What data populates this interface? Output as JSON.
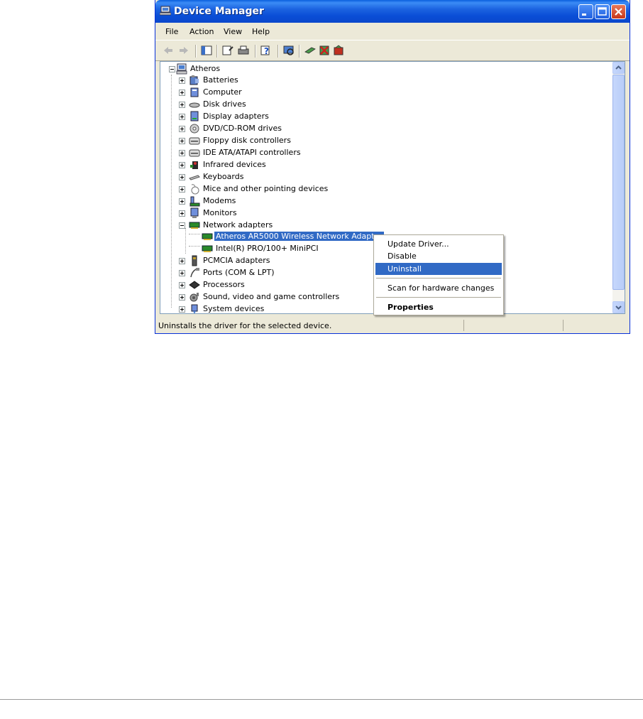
{
  "window": {
    "title": "Device Manager"
  },
  "menu": [
    "File",
    "Action",
    "View",
    "Help"
  ],
  "toolbar_icons": [
    "back-icon",
    "forward-icon",
    "show-hide-console-tree-icon",
    "properties-icon",
    "print-icon",
    "help-icon",
    "scan-hardware-icon",
    "update-driver-icon",
    "disable-device-icon",
    "uninstall-device-icon"
  ],
  "tree": {
    "root": "Atheros",
    "categories": [
      {
        "label": "Batteries",
        "icon": "battery-icon"
      },
      {
        "label": "Computer",
        "icon": "computer-icon"
      },
      {
        "label": "Disk drives",
        "icon": "disk-drive-icon"
      },
      {
        "label": "Display adapters",
        "icon": "display-adapter-icon"
      },
      {
        "label": "DVD/CD-ROM drives",
        "icon": "dvd-drive-icon"
      },
      {
        "label": "Floppy disk controllers",
        "icon": "floppy-controller-icon"
      },
      {
        "label": "IDE ATA/ATAPI controllers",
        "icon": "ide-controller-icon"
      },
      {
        "label": "Infrared devices",
        "icon": "infrared-icon"
      },
      {
        "label": "Keyboards",
        "icon": "keyboard-icon"
      },
      {
        "label": "Mice and other pointing devices",
        "icon": "mouse-icon"
      },
      {
        "label": "Modems",
        "icon": "modem-icon"
      },
      {
        "label": "Monitors",
        "icon": "monitor-icon"
      },
      {
        "label": "Network adapters",
        "icon": "network-adapter-icon",
        "expanded": true,
        "children": [
          "Atheros AR5000 Wireless Network Adapter",
          "Intel(R) PRO/100+ MiniPCI"
        ]
      },
      {
        "label": "PCMCIA adapters",
        "icon": "pcmcia-icon"
      },
      {
        "label": "Ports (COM & LPT)",
        "icon": "port-icon"
      },
      {
        "label": "Processors",
        "icon": "processor-icon"
      },
      {
        "label": "Sound, video and game controllers",
        "icon": "sound-icon"
      },
      {
        "label": "System devices",
        "icon": "system-device-icon"
      }
    ],
    "selected_child": "Atheros AR5000 Wireless Network Adapter"
  },
  "context_menu": {
    "items": [
      "Update Driver...",
      "Disable",
      "Uninstall",
      "Scan for hardware changes",
      "Properties"
    ],
    "highlighted": "Uninstall"
  },
  "status": {
    "text": "Uninstalls the driver for the selected device."
  },
  "colors": {
    "title_bar": "#0a4ed6",
    "selection": "#316ac5",
    "window_face": "#ece9d8"
  }
}
